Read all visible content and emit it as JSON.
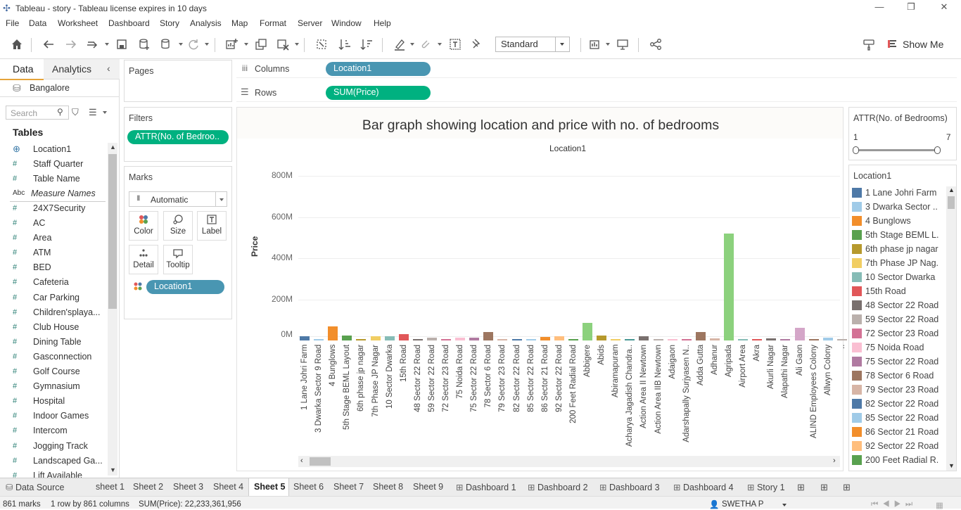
{
  "window": {
    "title": "Tableau - story - Tableau license expires in 10 days"
  },
  "menus": [
    "File",
    "Data",
    "Worksheet",
    "Dashboard",
    "Story",
    "Analysis",
    "Map",
    "Format",
    "Server",
    "Window",
    "Help"
  ],
  "toolbar": {
    "fit_mode": "Standard",
    "show_me": "Show Me"
  },
  "data_pane": {
    "tab_data": "Data",
    "tab_analytics": "Analytics",
    "datasource": "Bangalore",
    "search_placeholder": "Search",
    "tables_label": "Tables",
    "fields": [
      {
        "icon": "⊕",
        "name": "Location1"
      },
      {
        "icon": "#",
        "name": "Staff Quarter"
      },
      {
        "icon": "#",
        "name": "Table Name"
      },
      {
        "icon": "Abc",
        "name": "Measure Names"
      },
      {
        "icon": "#",
        "name": "24X7Security"
      },
      {
        "icon": "#",
        "name": "AC"
      },
      {
        "icon": "#",
        "name": "Area"
      },
      {
        "icon": "#",
        "name": "ATM"
      },
      {
        "icon": "#",
        "name": "BED"
      },
      {
        "icon": "#",
        "name": "Cafeteria"
      },
      {
        "icon": "#",
        "name": "Car Parking"
      },
      {
        "icon": "#",
        "name": "Children'splaya..."
      },
      {
        "icon": "#",
        "name": "Club House"
      },
      {
        "icon": "#",
        "name": "Dining Table"
      },
      {
        "icon": "#",
        "name": "Gasconnection"
      },
      {
        "icon": "#",
        "name": "Golf Course"
      },
      {
        "icon": "#",
        "name": "Gymnasium"
      },
      {
        "icon": "#",
        "name": "Hospital"
      },
      {
        "icon": "#",
        "name": "Indoor Games"
      },
      {
        "icon": "#",
        "name": "Intercom"
      },
      {
        "icon": "#",
        "name": "Jogging Track"
      },
      {
        "icon": "#",
        "name": "Landscaped Ga..."
      },
      {
        "icon": "#",
        "name": "Lift Available"
      }
    ]
  },
  "shelves": {
    "pages": "Pages",
    "filters": "Filters",
    "filter_pill": "ATTR(No. of Bedroo..",
    "marks": "Marks",
    "mark_type": "Automatic",
    "mark_buttons": [
      "Color",
      "Size",
      "Label",
      "Detail",
      "Tooltip"
    ],
    "marks_pill": "Location1",
    "columns_label": "Columns",
    "columns_pill": "Location1",
    "rows_label": "Rows",
    "rows_pill": "SUM(Price)"
  },
  "slider": {
    "title": "ATTR(No. of Bedrooms)",
    "min": "1",
    "max": "7"
  },
  "legend": {
    "title": "Location1",
    "items": [
      {
        "label": "1 Lane Johri Farm",
        "color": "#4e79a7"
      },
      {
        "label": "3 Dwarka Sector ..",
        "color": "#a0cbe8"
      },
      {
        "label": "4 Bunglows",
        "color": "#f28e2b"
      },
      {
        "label": "5th Stage BEML L..",
        "color": "#59a14f"
      },
      {
        "label": "6th phase jp nagar",
        "color": "#b6992d"
      },
      {
        "label": "7th Phase JP Nag..",
        "color": "#f1ce63"
      },
      {
        "label": "10 Sector Dwarka",
        "color": "#86bcb6"
      },
      {
        "label": "15th Road",
        "color": "#e15759"
      },
      {
        "label": "48 Sector 22 Road",
        "color": "#79706e"
      },
      {
        "label": "59 Sector 22 Road",
        "color": "#bab0ac"
      },
      {
        "label": "72 Sector 23 Road",
        "color": "#d37295"
      },
      {
        "label": "75 Noida Road",
        "color": "#fabfd2"
      },
      {
        "label": "75 Sector 22 Road",
        "color": "#b07aa1"
      },
      {
        "label": "78 Sector 6 Road",
        "color": "#9d7660"
      },
      {
        "label": "79 Sector 23 Road",
        "color": "#d7b5a6"
      },
      {
        "label": "82 Sector 22 Road",
        "color": "#4e79a7"
      },
      {
        "label": "85 Sector 22 Road",
        "color": "#a0cbe8"
      },
      {
        "label": "86 Sector 21 Road",
        "color": "#f28e2b"
      },
      {
        "label": "92 Sector 22 Road",
        "color": "#ffbe7d"
      },
      {
        "label": "200 Feet Radial R..",
        "color": "#59a14f"
      }
    ]
  },
  "chart_data": {
    "type": "bar",
    "title": "Bar graph showing location and price with no. of bedrooms",
    "header": "Location1",
    "ylabel": "Price",
    "yticks": [
      "800M",
      "600M",
      "400M",
      "200M",
      "0M"
    ],
    "ylim": [
      0,
      800000000
    ],
    "categories": [
      "1 Lane Johri Farm",
      "3 Dwarka Sector 9 Road",
      "4 Bunglows",
      "5th Stage BEML Layout",
      "6th phase jp nagar",
      "7th Phase JP Nagar",
      "10 Sector Dwarka",
      "15th Road",
      "48 Sector 22 Road",
      "59 Sector 22 Road",
      "72 Sector 23 Road",
      "75 Noida Road",
      "75 Sector 22 Road",
      "78 Sector 6 Road",
      "79 Sector 23 Road",
      "82 Sector 22 Road",
      "85 Sector 22 Road",
      "86 Sector 21 Road",
      "92 Sector 22 Road",
      "200 Feet Radial Road",
      "Abbigere",
      "Abids",
      "Abiramapuram",
      "Acharya Jagadish Chandra..",
      "Action Area II Newtown",
      "Action Area IIB Newtown",
      "Adaigaon",
      "Adarshapally Surjyasen N..",
      "Adda Gutta",
      "Adhanur",
      "Agripada",
      "Airport Area",
      "Akra",
      "Akurli Nagar",
      "Alapathi Nagar",
      "Ali Gaon",
      "ALIND Employees Colony",
      "Allwyn Colony",
      ".."
    ],
    "values": [
      20000000,
      3000000,
      70000000,
      25000000,
      8000000,
      20000000,
      22000000,
      32000000,
      6000000,
      12000000,
      4000000,
      12000000,
      12000000,
      40000000,
      6000000,
      6000000,
      8000000,
      16000000,
      20000000,
      6000000,
      85000000,
      25000000,
      6000000,
      4000000,
      20000000,
      5000000,
      4000000,
      3000000,
      40000000,
      10000000,
      520000000,
      5000000,
      8000000,
      10000000,
      5000000,
      60000000,
      6000000,
      12000000,
      2000000
    ],
    "colors": [
      "#4e79a7",
      "#a0cbe8",
      "#f28e2b",
      "#59a14f",
      "#b6992d",
      "#f1ce63",
      "#86bcb6",
      "#e15759",
      "#79706e",
      "#bab0ac",
      "#d37295",
      "#fabfd2",
      "#b07aa1",
      "#9d7660",
      "#d7b5a6",
      "#4e79a7",
      "#a0cbe8",
      "#f28e2b",
      "#ffbe7d",
      "#59a14f",
      "#8cd17d",
      "#b6992d",
      "#f1ce63",
      "#499894",
      "#79706e",
      "#bab0ac",
      "#fabfd2",
      "#d37295",
      "#9d7660",
      "#d7b5a6",
      "#8cd17d",
      "#86bcb6",
      "#e15759",
      "#79706e",
      "#b07aa1",
      "#d4a6c8",
      "#9d7660",
      "#a0cbe8",
      "#bab0ac"
    ]
  },
  "tabs": [
    "Data Source",
    "sheet 1",
    "Sheet 2",
    "Sheet 3",
    "Sheet 4",
    "Sheet 5",
    "Sheet 6",
    "Sheet 7",
    "Sheet 8",
    "Sheet 9",
    "Dashboard 1",
    "Dashboard 2",
    "Dashboard 3",
    "Dashboard 4",
    "Story 1"
  ],
  "status": {
    "marks": "861 marks",
    "dims": "1 row by 861 columns",
    "sum": "SUM(Price): 22,233,361,956",
    "user": "SWETHA P"
  }
}
